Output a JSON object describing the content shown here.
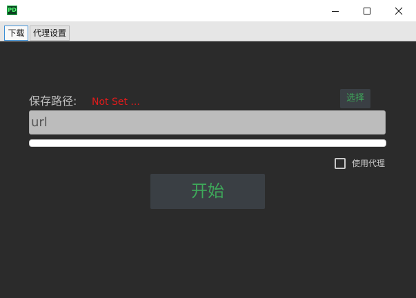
{
  "window": {
    "icon_text": "PD",
    "controls": [
      "minimize-icon",
      "maximize-icon",
      "close-icon"
    ]
  },
  "tabs": [
    {
      "label": "下载",
      "active": true
    },
    {
      "label": "代理设置",
      "active": false
    }
  ],
  "download": {
    "path_label": "保存路径:",
    "path_value": "Not Set ...",
    "choose_label": "选择",
    "url_placeholder": "url",
    "url_value": "",
    "progress": 0,
    "use_proxy_label": "使用代理",
    "use_proxy_checked": false,
    "start_label": "开始"
  },
  "colors": {
    "background": "#2b2b2b",
    "accent_green": "#3ea85a",
    "error_red": "#e01b1b",
    "button_bg": "#3a3f44"
  }
}
